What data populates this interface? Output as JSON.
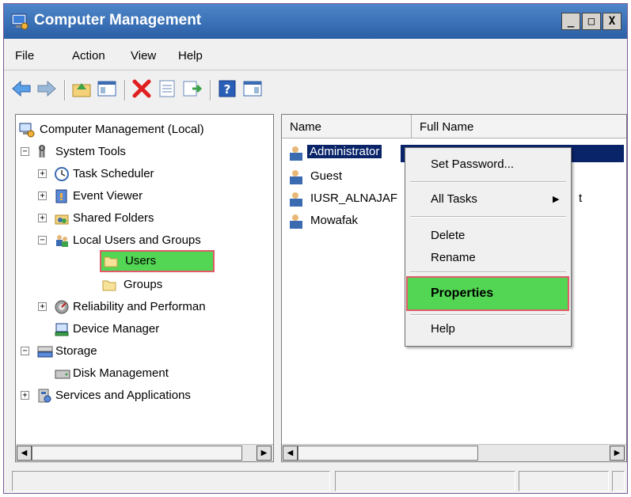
{
  "window": {
    "title": "Computer Management",
    "minimize_glyph": "_",
    "maximize_glyph": "□",
    "close_glyph": "X"
  },
  "menu": {
    "items": [
      "File",
      "Action",
      "View",
      "Help"
    ]
  },
  "tree": {
    "root": "Computer Management (Local)",
    "system_tools": "System Tools",
    "task_scheduler": "Task Scheduler",
    "event_viewer": "Event Viewer",
    "shared_folders": "Shared Folders",
    "local_users_groups": "Local Users and Groups",
    "users": "Users",
    "groups": "Groups",
    "reliability": "Reliability and Performan",
    "device_manager": "Device Manager",
    "storage": "Storage",
    "disk_management": "Disk Management",
    "services_apps": "Services and Applications"
  },
  "list": {
    "columns": [
      "Name",
      "Full Name"
    ],
    "rows": [
      "Administrator",
      "Guest",
      "IUSR_ALNAJAF",
      "Mowafak"
    ],
    "partial_text": "t"
  },
  "context_menu": {
    "set_password": "Set Password...",
    "all_tasks": "All Tasks",
    "delete": "Delete",
    "rename": "Rename",
    "properties": "Properties",
    "help": "Help"
  },
  "colors": {
    "highlight_fill": "#53d653",
    "highlight_border": "#e05a6a",
    "selection_blue": "#0a246a"
  }
}
